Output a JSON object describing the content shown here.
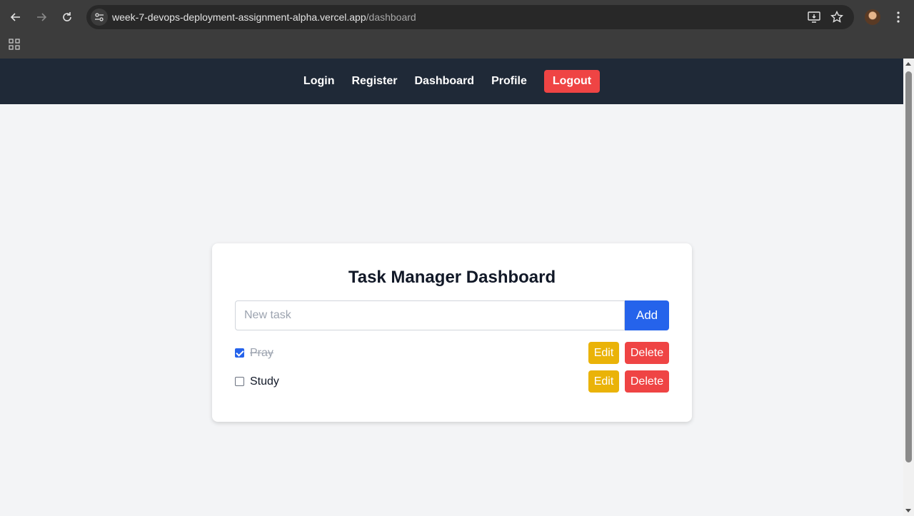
{
  "browser": {
    "url_host": "week-7-devops-deployment-assignment-alpha.vercel.app",
    "url_path": "/dashboard",
    "icons": [
      "back-icon",
      "forward-icon",
      "reload-icon",
      "site-info-icon",
      "install-app-icon",
      "bookmark-star-icon",
      "profile-avatar",
      "menu-icon",
      "apps-icon"
    ]
  },
  "nav": {
    "login": "Login",
    "register": "Register",
    "dashboard": "Dashboard",
    "profile": "Profile",
    "logout": "Logout"
  },
  "dashboard": {
    "title": "Task Manager Dashboard",
    "input_placeholder": "New task",
    "input_value": "",
    "add_label": "Add",
    "tasks": [
      {
        "label": "Pray",
        "completed": true,
        "edit_label": "Edit",
        "delete_label": "Delete"
      },
      {
        "label": "Study",
        "completed": false,
        "edit_label": "Edit",
        "delete_label": "Delete"
      }
    ]
  },
  "colors": {
    "nav_bg": "#1f2937",
    "logout_bg": "#ef4444",
    "add_bg": "#2563eb",
    "edit_bg": "#eab308",
    "delete_bg": "#ef4444",
    "page_bg": "#f3f4f6"
  }
}
